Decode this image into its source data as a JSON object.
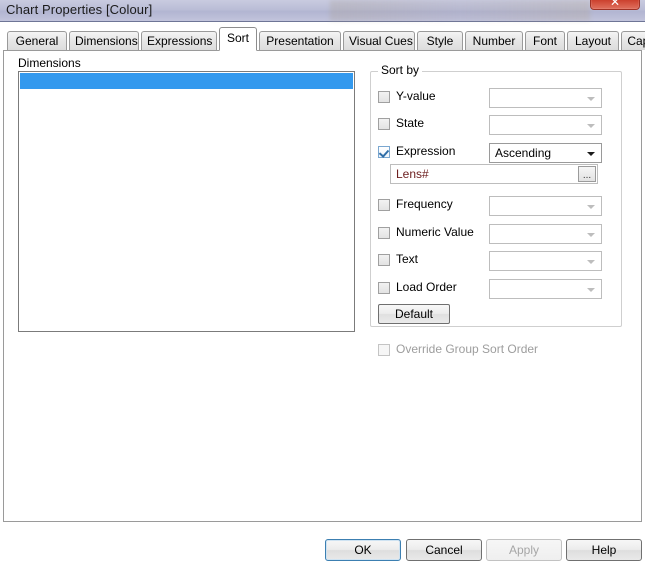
{
  "window": {
    "title": "Chart Properties [Colour]",
    "close_glyph": "✕"
  },
  "tabs": [
    {
      "label": "General",
      "active": false
    },
    {
      "label": "Dimensions",
      "active": false
    },
    {
      "label": "Expressions",
      "active": false
    },
    {
      "label": "Sort",
      "active": true
    },
    {
      "label": "Presentation",
      "active": false
    },
    {
      "label": "Visual Cues",
      "active": false
    },
    {
      "label": "Style",
      "active": false
    },
    {
      "label": "Number",
      "active": false
    },
    {
      "label": "Font",
      "active": false
    },
    {
      "label": "Layout",
      "active": false
    },
    {
      "label": "Caption",
      "active": false
    }
  ],
  "dimensions": {
    "label": "Dimensions",
    "items": [
      {
        "label": "",
        "selected": true
      }
    ]
  },
  "sort_by": {
    "legend": "Sort by",
    "rows": [
      {
        "label": "Y-value",
        "checked": false,
        "combo_value": ""
      },
      {
        "label": "State",
        "checked": false,
        "combo_value": ""
      },
      {
        "label": "Expression",
        "checked": true,
        "combo_value": "Ascending"
      },
      {
        "label": "Frequency",
        "checked": false,
        "combo_value": ""
      },
      {
        "label": "Numeric Value",
        "checked": false,
        "combo_value": ""
      },
      {
        "label": "Text",
        "checked": false,
        "combo_value": ""
      },
      {
        "label": "Load Order",
        "checked": false,
        "combo_value": ""
      }
    ],
    "expression_field": {
      "value": "Lens#",
      "browse_label": "...",
      "text_color": "#6e2020"
    },
    "default_button": "Default"
  },
  "override_group_sort_order": {
    "label": "Override Group Sort Order",
    "checked": false,
    "enabled": false
  },
  "footer": {
    "ok": "OK",
    "cancel": "Cancel",
    "apply": "Apply",
    "help": "Help"
  },
  "colors": {
    "selection_blue": "#3399ee",
    "close_red": "#d94a37",
    "titlebar": "#b9bcd5"
  }
}
